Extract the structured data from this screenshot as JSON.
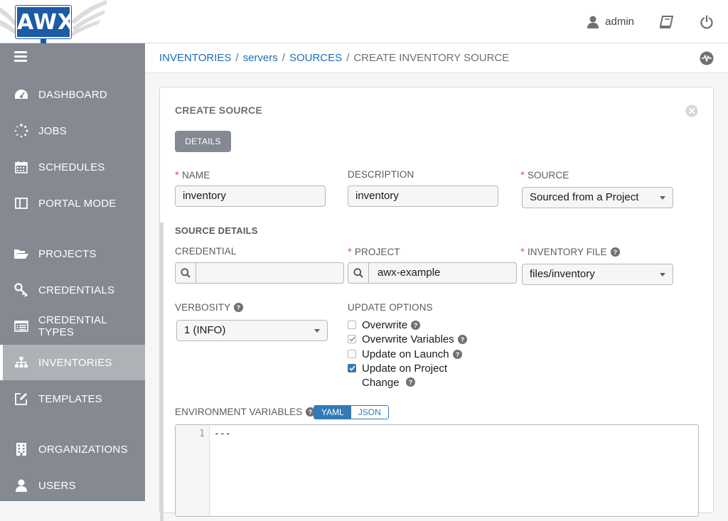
{
  "header": {
    "logo_text": "AWX",
    "user_name": "admin",
    "colors": {
      "brand": "#1d5ba7",
      "sidebar": "#848992",
      "link": "#1a6fb8",
      "required": "#d9534f"
    }
  },
  "sidebar": {
    "items": [
      {
        "label": "DASHBOARD",
        "icon": "dashboard-icon"
      },
      {
        "label": "JOBS",
        "icon": "jobs-spinner-icon"
      },
      {
        "label": "SCHEDULES",
        "icon": "calendar-icon"
      },
      {
        "label": "PORTAL MODE",
        "icon": "portal-icon"
      },
      {
        "label": "PROJECTS",
        "icon": "folder-open-icon"
      },
      {
        "label": "CREDENTIALS",
        "icon": "key-icon"
      },
      {
        "label": "CREDENTIAL TYPES",
        "icon": "list-alt-icon"
      },
      {
        "label": "INVENTORIES",
        "icon": "sitemap-icon",
        "active": true
      },
      {
        "label": "TEMPLATES",
        "icon": "edit-icon"
      },
      {
        "label": "ORGANIZATIONS",
        "icon": "building-icon"
      },
      {
        "label": "USERS",
        "icon": "user-icon"
      }
    ]
  },
  "breadcrumb": {
    "items": [
      "INVENTORIES",
      "servers",
      "SOURCES"
    ],
    "separator": "/",
    "current": "CREATE INVENTORY SOURCE"
  },
  "form": {
    "title": "CREATE SOURCE",
    "tab_details": "DETAILS",
    "required_mark": "*",
    "name": {
      "label": "NAME",
      "value": "inventory"
    },
    "description": {
      "label": "DESCRIPTION",
      "value": "inventory"
    },
    "source": {
      "label": "SOURCE",
      "value": "Sourced from a Project"
    },
    "source_details_heading": "SOURCE DETAILS",
    "credential": {
      "label": "CREDENTIAL",
      "value": ""
    },
    "project": {
      "label": "PROJECT",
      "value": "awx-example"
    },
    "inventory_file": {
      "label": "INVENTORY FILE",
      "value": "files/inventory"
    },
    "verbosity": {
      "label": "VERBOSITY",
      "value": "1 (INFO)"
    },
    "update_options": {
      "label": "UPDATE OPTIONS",
      "overwrite": {
        "label": "Overwrite",
        "checked": false
      },
      "overwrite_vars": {
        "label": "Overwrite Variables",
        "checked": true
      },
      "update_on_launch": {
        "label": "Update on Launch",
        "checked": false
      },
      "update_on_project_change": {
        "label_line1": "Update on Project",
        "label_line2": "Change",
        "checked": true
      }
    },
    "env_vars": {
      "label": "ENVIRONMENT VARIABLES",
      "toggle_yaml": "YAML",
      "toggle_json": "JSON",
      "line_number": "1",
      "line_text": "---"
    }
  }
}
